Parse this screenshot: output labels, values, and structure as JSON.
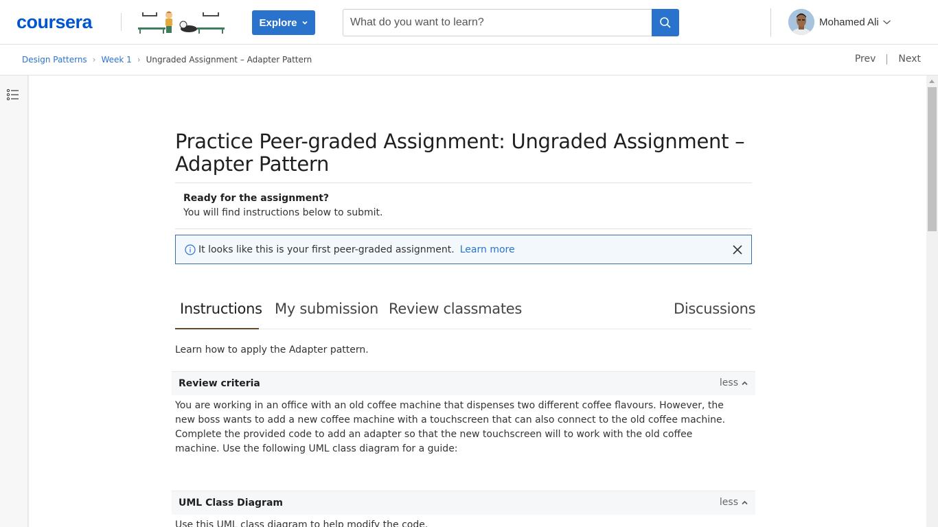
{
  "header": {
    "logo_text": "coursera",
    "explore_label": "Explore",
    "search": {
      "placeholder": "What do you want to learn?"
    },
    "user": {
      "name": "Mohamed Ali"
    }
  },
  "breadcrumb": {
    "items": [
      "Design Patterns",
      "Week 1"
    ],
    "current": "Ungraded Assignment – Adapter Pattern",
    "separator": "›"
  },
  "pager": {
    "prev": "Prev",
    "next": "Next"
  },
  "page": {
    "title": "Practice Peer-graded Assignment: Ungraded Assignment – Adapter Pattern",
    "ready_heading": "Ready for the assignment?",
    "ready_text": "You will find instructions below to submit.",
    "banner": {
      "text": "It looks like this is your first peer-graded assignment.",
      "link": "Learn more"
    },
    "tabs": [
      {
        "label": "Instructions",
        "active": true
      },
      {
        "label": "My submission",
        "active": false
      },
      {
        "label": "Review classmates",
        "active": false
      },
      {
        "label": "Discussions",
        "active": false
      }
    ],
    "intro": "Learn how to apply the Adapter pattern.",
    "sections": [
      {
        "heading": "Review criteria",
        "toggle": "less",
        "body": "You are working in an office with an old coffee machine that dispenses two different coffee flavours. However, the new boss wants to add a new coffee machine with a touchscreen that can also connect to the old coffee machine. Complete the provided code to add an adapter so that the new touchscreen will to work with the old coffee machine. Use the following UML class diagram for a guide:"
      },
      {
        "heading": "UML Class Diagram",
        "toggle": "less",
        "body": "Use this UML class diagram to help modify the code."
      }
    ]
  },
  "colors": {
    "brand": "#0056d2",
    "button": "#2a73cc",
    "link": "#2a73cc",
    "banner_border": "#3c6aa8",
    "tab_underline": "#5e4a2a"
  }
}
